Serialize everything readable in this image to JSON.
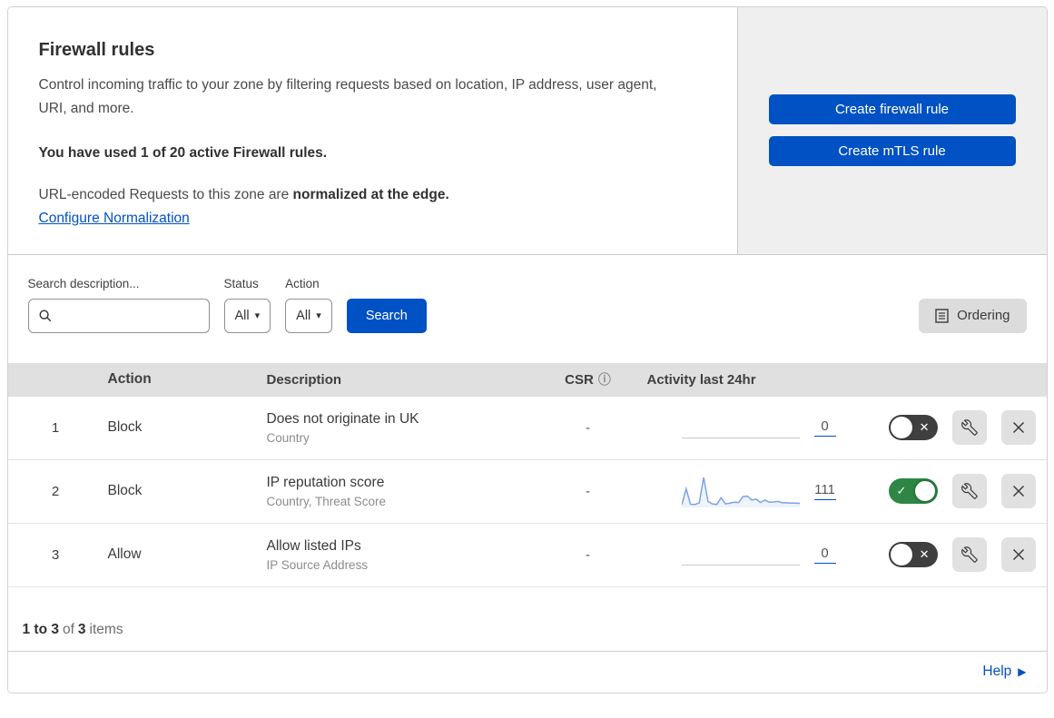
{
  "header": {
    "title": "Firewall rules",
    "description": "Control incoming traffic to your zone by filtering requests based on location, IP address, user agent, URI, and more.",
    "usage_note": "You have used 1 of 20 active Firewall rules.",
    "normalization_text": "URL-encoded Requests to this zone are ",
    "normalization_bold": "normalized at the edge.",
    "normalization_link": "Configure Normalization",
    "buttons": {
      "create_firewall": "Create firewall rule",
      "create_mtls": "Create mTLS rule"
    }
  },
  "filters": {
    "search_label": "Search description...",
    "search_value": "",
    "search_placeholder": "",
    "status_label": "Status",
    "status_value": "All",
    "action_label": "Action",
    "action_value": "All",
    "search_button": "Search",
    "ordering_button": "Ordering"
  },
  "table": {
    "columns": {
      "action": "Action",
      "description": "Description",
      "csr": "CSR",
      "activity": "Activity last 24hr"
    },
    "rows": [
      {
        "priority": "1",
        "action": "Block",
        "description": "Does not originate in UK",
        "fields": "Country",
        "csr": "-",
        "activity_count": "0",
        "enabled": false,
        "sparkline": []
      },
      {
        "priority": "2",
        "action": "Block",
        "description": "IP reputation score",
        "fields": "Country, Threat Score",
        "csr": "-",
        "activity_count": "111",
        "enabled": true,
        "sparkline": [
          3,
          60,
          5,
          4,
          10,
          100,
          15,
          6,
          4,
          28,
          6,
          9,
          12,
          11,
          32,
          34,
          20,
          23,
          11,
          20,
          12,
          13,
          15,
          10,
          10,
          9,
          9,
          8
        ]
      },
      {
        "priority": "3",
        "action": "Allow",
        "description": "Allow listed IPs",
        "fields": "IP Source Address",
        "csr": "-",
        "activity_count": "0",
        "enabled": false,
        "sparkline": []
      }
    ]
  },
  "footer": {
    "range_bold": "1 to 3",
    "of_text": "of",
    "total_bold": "3",
    "items_text": "items",
    "help_link": "Help"
  },
  "icons": {
    "info": "ⓘ",
    "caret_down": "▾",
    "help_arrow": "▶",
    "toggle_check": "✓",
    "toggle_cross": "✕"
  },
  "colors": {
    "accent_blue": "#0051c3",
    "toggle_on_green": "#2e8644",
    "toggle_off_dark": "#3f3f3f",
    "sparkline_stroke": "#7ba3e3",
    "sparkline_fill": "#eef3fc",
    "panel_gray": "#efefef",
    "table_header_gray": "#e0e0e0"
  }
}
